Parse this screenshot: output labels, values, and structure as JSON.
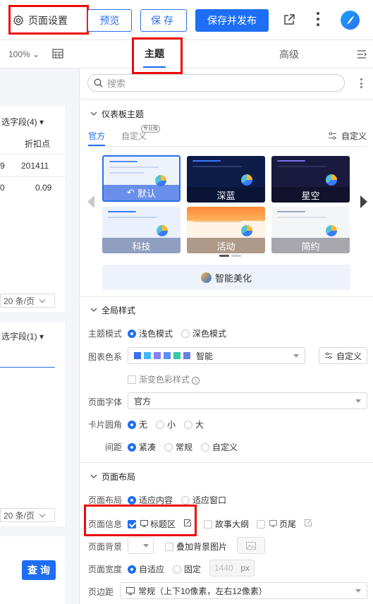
{
  "toolbar": {
    "page_settings": "页面设置",
    "preview": "预览",
    "save": "保存",
    "save_publish": "保存并发布"
  },
  "left": {
    "zoom": "100%",
    "field1": "选字段(4)",
    "col_header": "折扣点",
    "row1_left": "9",
    "row1_right": "201411",
    "row2_left": "0",
    "row2_right": "0.09",
    "page_size1": "20 条/页",
    "field2": "选字段(1)",
    "page_size2": "20 条/页",
    "query": "查 询"
  },
  "tabs": {
    "theme": "主题",
    "advanced": "高级"
  },
  "search": {
    "placeholder": "搜索"
  },
  "dashboard_theme": {
    "title": "仪表板主题",
    "tab_official": "官方",
    "tab_custom": "自定义",
    "pro_badge": "专业版",
    "custom_link": "自定义",
    "themes": [
      "默认",
      "深蓝",
      "星空",
      "科技",
      "活动",
      "简约"
    ],
    "smart_beautify": "智能美化"
  },
  "global_style": {
    "title": "全局样式",
    "theme_mode_label": "主题模式",
    "light_mode": "浅色模式",
    "dark_mode": "深色模式",
    "palette_label": "图表色系",
    "palette_value": "智能",
    "palette_colors": [
      "#3a6df0",
      "#43b7f5",
      "#8b7ff2",
      "#5b8ff9",
      "#37c7a3",
      "#6d7fe0"
    ],
    "custom_btn": "自定义",
    "gradient": "渐变色彩样式",
    "font_label": "页面字体",
    "font_value": "官方",
    "radius_label": "卡片圆角",
    "radius_none": "无",
    "radius_small": "小",
    "radius_large": "大",
    "spacing_label": "间距",
    "spacing_compact": "紧凑",
    "spacing_normal": "常规",
    "spacing_custom": "自定义"
  },
  "page_layout": {
    "title": "页面布局",
    "layout_label": "页面布局",
    "fit_content": "适应内容",
    "fit_window": "适应窗口",
    "info_label": "页面信息",
    "title_area": "标题区",
    "story_outline": "故事大纲",
    "footer": "页尾",
    "bg_label": "页面背景",
    "overlay_bg": "叠加背景图片",
    "width_label": "页面宽度",
    "adaptive": "自适应",
    "fixed": "固定",
    "width_value": "1440",
    "width_unit": "px",
    "margin_label": "页边距",
    "margin_value": "常规（上下10像素，左右12像素）"
  }
}
